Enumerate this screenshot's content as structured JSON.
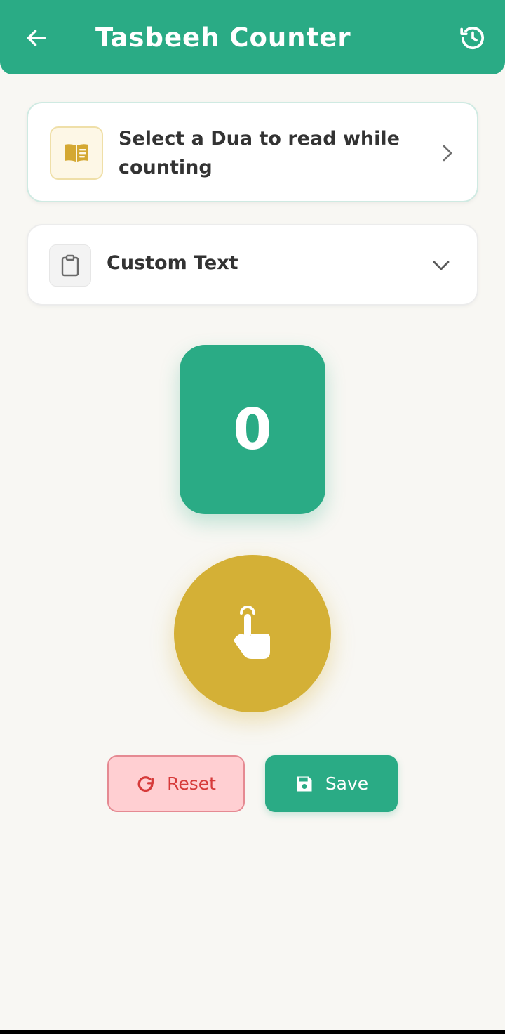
{
  "header": {
    "title": "Tasbeeh Counter",
    "back_icon": "arrow-left-icon",
    "history_icon": "history-icon"
  },
  "dua_selector": {
    "label": "Select a Dua to read while counting",
    "icon": "book-icon",
    "chevron_icon": "chevron-right-icon"
  },
  "custom_text": {
    "label": "Custom Text",
    "icon": "clipboard-icon",
    "chevron_icon": "chevron-down-icon"
  },
  "counter": {
    "value": "0"
  },
  "tap_button": {
    "icon": "hand-pointer-icon"
  },
  "actions": {
    "reset_label": "Reset",
    "save_label": "Save"
  },
  "colors": {
    "primary": "#2aab85",
    "accent": "#d4b036",
    "reset": "#d63a3a",
    "background": "#f8f7f3"
  }
}
